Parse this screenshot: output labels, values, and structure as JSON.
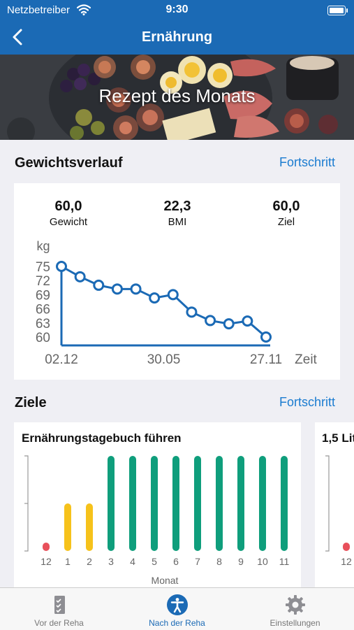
{
  "status_bar": {
    "carrier": "Netzbetreiber",
    "time": "9:30"
  },
  "nav": {
    "title": "Ernährung"
  },
  "hero": {
    "title": "Rezept des Monats"
  },
  "weight": {
    "section_title": "Gewichtsverlauf",
    "link": "Fortschritt",
    "stats": [
      {
        "value": "60,0",
        "label": "Gewicht"
      },
      {
        "value": "22,3",
        "label": "BMI"
      },
      {
        "value": "60,0",
        "label": "Ziel"
      }
    ]
  },
  "goals": {
    "section_title": "Ziele",
    "link": "Fortschritt"
  },
  "colors": {
    "brand": "#1b6ab5",
    "link": "#1b7cd0",
    "green": "#0f9e7c",
    "yellow": "#f6c21b",
    "red": "#e8505b"
  },
  "chart_data": [
    {
      "type": "line",
      "ylabel": "kg",
      "xlabel": "Zeit",
      "yticks": [
        "75",
        "72",
        "69",
        "66",
        "63",
        "60"
      ],
      "xticks": [
        "02.12",
        "30.05",
        "27.11"
      ],
      "ylim": [
        60,
        75
      ],
      "series": [
        {
          "values": [
            75,
            72.8,
            71,
            70.2,
            70.2,
            68.3,
            69,
            65.3,
            63.5,
            62.8,
            63.4,
            60
          ]
        }
      ]
    },
    {
      "type": "bar",
      "title": "Ernährungstagebuch führen",
      "xlabel": "Monat",
      "categories": [
        "12",
        "1",
        "2",
        "3",
        "4",
        "5",
        "6",
        "7",
        "8",
        "9",
        "10",
        "11"
      ],
      "values": [
        0.05,
        0.5,
        0.5,
        1,
        1,
        1,
        1,
        1,
        1,
        1,
        1,
        1
      ],
      "bar_colors": [
        "red",
        "yellow",
        "yellow",
        "green",
        "green",
        "green",
        "green",
        "green",
        "green",
        "green",
        "green",
        "green"
      ]
    },
    {
      "type": "bar",
      "title": "1,5 Lit",
      "categories": [
        "12"
      ],
      "values": [
        0.05
      ]
    }
  ],
  "tabs": [
    {
      "label": "Vor der Reha",
      "icon": "checklist-icon"
    },
    {
      "label": "Nach der Reha",
      "icon": "accessibility-icon"
    },
    {
      "label": "Einstellungen",
      "icon": "gear-icon"
    }
  ]
}
